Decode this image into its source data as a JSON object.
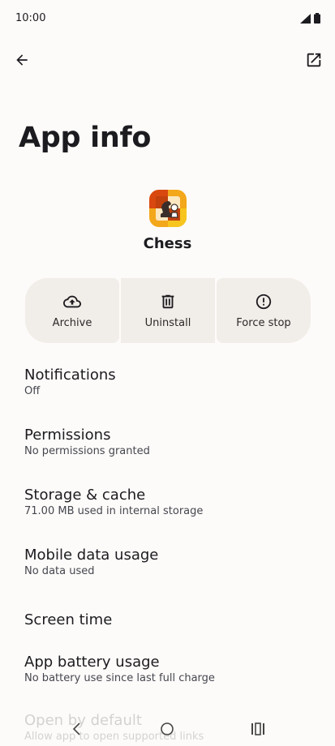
{
  "status": {
    "time": "10:00"
  },
  "page": {
    "title": "App info"
  },
  "app": {
    "name": "Chess"
  },
  "actions": [
    {
      "label": "Archive",
      "icon": "cloud-upload-icon"
    },
    {
      "label": "Uninstall",
      "icon": "trash-icon"
    },
    {
      "label": "Force stop",
      "icon": "alert-circle-icon"
    }
  ],
  "settings": [
    {
      "title": "Notifications",
      "sub": "Off"
    },
    {
      "title": "Permissions",
      "sub": "No permissions granted"
    },
    {
      "title": "Storage & cache",
      "sub": "71.00 MB used in internal storage"
    },
    {
      "title": "Mobile data usage",
      "sub": "No data used"
    },
    {
      "title": "Screen time"
    },
    {
      "title": "App battery usage",
      "sub": "No battery use since last full charge"
    },
    {
      "title": "Open by default",
      "sub": "Allow app to open supported links"
    }
  ],
  "colors": {
    "accent": "#f3a71a",
    "surface": "#f1ede8",
    "background": "#fdfbf9"
  }
}
